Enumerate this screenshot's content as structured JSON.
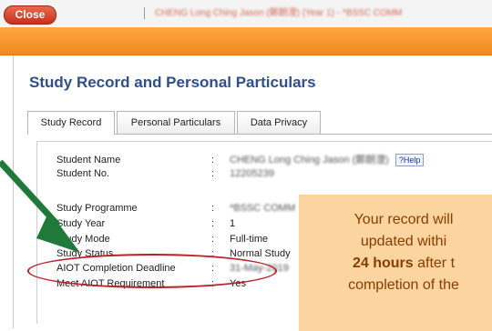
{
  "header": {
    "close_label": "Close",
    "user_info": "CHENG Long Ching Jason (鄭朗澄) (Year 1) - *BSSC COMM"
  },
  "page": {
    "title": "Study Record and Personal Particulars"
  },
  "tabs": [
    {
      "label": "Study Record",
      "active": true
    },
    {
      "label": "Personal Particulars",
      "active": false
    },
    {
      "label": "Data Privacy",
      "active": false
    }
  ],
  "record": {
    "colon": ":",
    "help_label": "?Help",
    "rows": [
      {
        "label": "Student Name",
        "value": "CHENG Long Ching Jason (鄭朗澄)"
      },
      {
        "label": "Student No.",
        "value": "12205239"
      },
      {
        "label": "Study Programme",
        "value": "*BSSC COMM"
      },
      {
        "label": "Study Year",
        "value": "1"
      },
      {
        "label": "Study Mode",
        "value": "Full-time"
      },
      {
        "label": "Study Status",
        "value": "Normal Study"
      },
      {
        "label": "AIOT Completion Deadline",
        "value": "31-May-2019"
      },
      {
        "label": "Meet AIOT Requirement",
        "value": "Yes"
      }
    ]
  },
  "callout": {
    "line1": "Your record will",
    "line2": "updated withi",
    "line3_bold": "24 hours",
    "line3_rest": " after t",
    "line4": "completion of the"
  },
  "colors": {
    "accent_orange": "#f39224",
    "title_blue": "#2e4f8a",
    "highlight_red": "#b9212a",
    "arrow_green": "#1f7a3a",
    "callout_bg": "#fbd4a0"
  }
}
